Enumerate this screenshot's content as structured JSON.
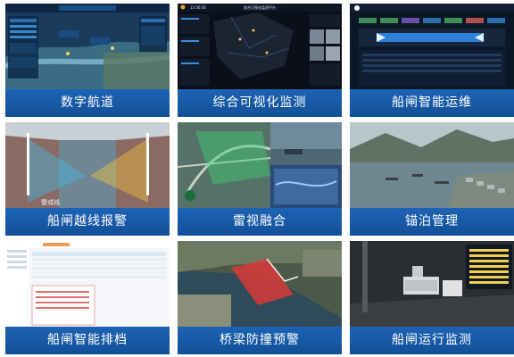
{
  "tiles": [
    {
      "id": "digital-navigation",
      "label": "数字航道"
    },
    {
      "id": "visual-monitoring",
      "label": "综合可视化监测"
    },
    {
      "id": "lock-maintenance",
      "label": "船闸智能运维"
    },
    {
      "id": "lock-alarm",
      "label": "船闸越线报警"
    },
    {
      "id": "radar-fusion",
      "label": "雷视融合"
    },
    {
      "id": "anchorage",
      "label": "锚泊管理"
    },
    {
      "id": "lock-scheduling",
      "label": "船闸智能排档"
    },
    {
      "id": "bridge-collision",
      "label": "桥梁防撞预警"
    },
    {
      "id": "lock-operation",
      "label": "船闸运行监测"
    }
  ],
  "thumbs": {
    "visual_monitoring_title": "综合可视化监测平台",
    "visual_monitoring_time": "13:56:56",
    "lock_alarm_watermark": "警戒线"
  },
  "colors": {
    "caption": "#1a5aab",
    "accent": "#2b8ae6"
  }
}
